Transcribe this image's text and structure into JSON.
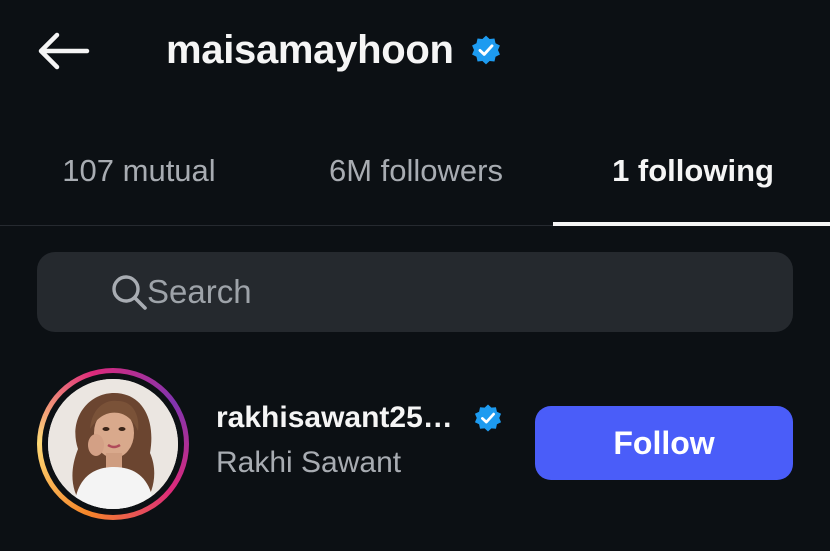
{
  "header": {
    "title": "maisamayhoon",
    "back_icon": "arrow-left-icon",
    "verified_icon": "verified-badge-icon"
  },
  "tabs": [
    {
      "label": "107 mutual",
      "active": false
    },
    {
      "label": "6M followers",
      "active": false
    },
    {
      "label": "1 following",
      "active": true
    }
  ],
  "search": {
    "placeholder": "Search",
    "icon": "search-icon"
  },
  "list": [
    {
      "username": "rakhisawant25…",
      "full_name": "Rakhi Sawant",
      "verified": true,
      "button_label": "Follow"
    }
  ],
  "colors": {
    "background": "#0c1014",
    "verified": "#1d9bf0",
    "follow_button": "#4a5df9",
    "search_bg": "#25292e",
    "muted_text": "#a8acb2"
  }
}
